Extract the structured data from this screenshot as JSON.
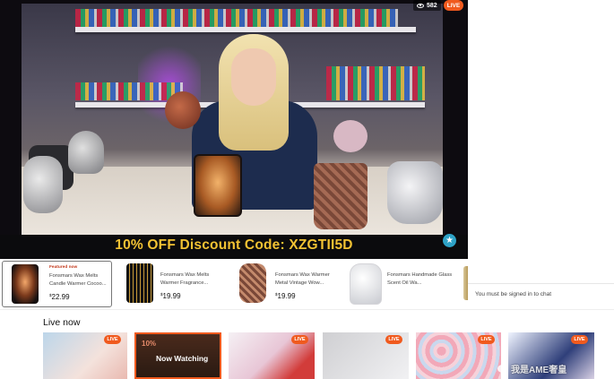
{
  "player": {
    "viewer_count": "582",
    "live_label": "LIVE",
    "discount_banner": "10% OFF Discount Code: XZGTII5D",
    "star_icon": "star-icon"
  },
  "chat": {
    "signin_message": "You must be signed in to chat"
  },
  "products": [
    {
      "featured": "Featured now",
      "title": "Fonsmars Wax Melts Candle Warmer Cocoo...",
      "price_symbol": "$",
      "price": "22.99"
    },
    {
      "featured": "",
      "title": "Fonsmars Wax Melts Warmer Fragrance...",
      "price_symbol": "$",
      "price": "19.99"
    },
    {
      "featured": "",
      "title": "Fonsmars Wax Warmer Metal Vintage Wow...",
      "price_symbol": "$",
      "price": "19.99"
    },
    {
      "featured": "",
      "title": "Fonsmars Handmade Glass Scent Oil Wa...",
      "price_symbol": "",
      "price": ""
    }
  ],
  "live_now": {
    "heading": "Live now",
    "tiles": [
      {
        "live_label": "LIVE"
      },
      {
        "live_label": "",
        "now_watching": "Now Watching",
        "promo": "10%"
      },
      {
        "live_label": "LIVE"
      },
      {
        "live_label": "LIVE"
      },
      {
        "live_label": "LIVE"
      },
      {
        "live_label": "LIVE"
      }
    ]
  },
  "watermark": "我是AME奢皇",
  "colors": {
    "live_accent": "#f05a1e",
    "discount_text": "#f2c233",
    "featured_text": "#c33a1d"
  }
}
